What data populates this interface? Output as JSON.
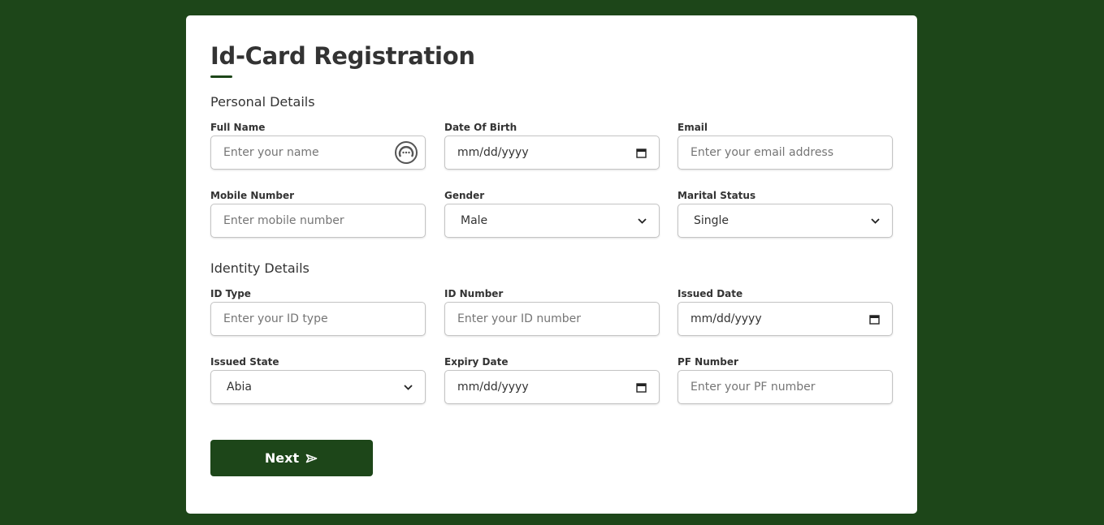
{
  "title": "Id-Card Registration",
  "colors": {
    "background": "#1d4619",
    "accent": "#1d4619",
    "card": "#ffffff",
    "text": "#333333"
  },
  "personal": {
    "heading": "Personal Details",
    "full_name": {
      "label": "Full Name",
      "placeholder": "Enter your name",
      "icon": "password-manager-icon"
    },
    "dob": {
      "label": "Date Of Birth",
      "value": "mm/dd/yyyy",
      "icon": "calendar-icon"
    },
    "email": {
      "label": "Email",
      "placeholder": "Enter your email address"
    },
    "mobile": {
      "label": "Mobile Number",
      "placeholder": "Enter mobile number"
    },
    "gender": {
      "label": "Gender",
      "value": "Male",
      "icon": "chevron-down-icon"
    },
    "marital": {
      "label": "Marital Status",
      "value": "Single",
      "icon": "chevron-down-icon"
    }
  },
  "identity": {
    "heading": "Identity Details",
    "id_type": {
      "label": "ID Type",
      "placeholder": "Enter your ID type"
    },
    "id_number": {
      "label": "ID Number",
      "placeholder": "Enter your ID number"
    },
    "issued_date": {
      "label": "Issued Date",
      "value": "mm/dd/yyyy",
      "icon": "calendar-icon"
    },
    "issued_state": {
      "label": "Issued State",
      "value": "Abia",
      "icon": "chevron-down-icon"
    },
    "expiry_date": {
      "label": "Expiry Date",
      "value": "mm/dd/yyyy",
      "icon": "calendar-icon"
    },
    "pf_number": {
      "label": "PF Number",
      "placeholder": "Enter your PF number"
    }
  },
  "next_button": {
    "label": "Next",
    "icon": "send-arrow-icon"
  }
}
